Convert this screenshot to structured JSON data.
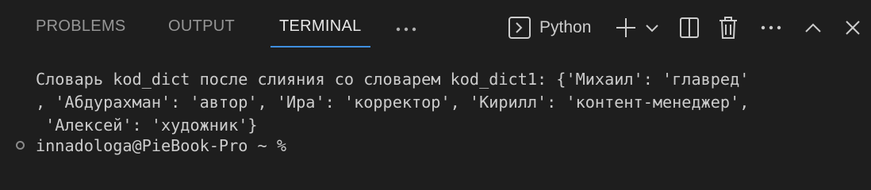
{
  "tabs": {
    "problems": "PROBLEMS",
    "output": "OUTPUT",
    "terminal": "TERMINAL"
  },
  "active_tab": "TERMINAL",
  "toolbar": {
    "terminal_profile": "Python"
  },
  "icons": {
    "more_tabs": "ellipsis-icon",
    "terminal_profile": "terminal-icon",
    "new_terminal": "plus-icon",
    "profile_dropdown": "chevron-down-icon",
    "split": "split-icon",
    "kill": "trash-icon",
    "more_actions": "ellipsis-icon",
    "maximize": "chevron-up-icon",
    "close": "close-icon"
  },
  "terminal": {
    "lines": [
      "Словарь kod_dict после слияния со словарем kod_dict1: {'Михаил': 'главред'",
      ", 'Абдурахман': 'автор', 'Ира': 'корректор', 'Кирилл': 'контент-менеджер',",
      " 'Алексей': 'художник'}"
    ],
    "prompt": "innadologa@PieBook-Pro ~ %"
  },
  "colors": {
    "background": "#1e1e1e",
    "active_tab_underline": "#3f8fe0",
    "inactive_tab_text": "#969696",
    "active_tab_text": "#e7e7e7",
    "terminal_text": "#cccccc"
  }
}
